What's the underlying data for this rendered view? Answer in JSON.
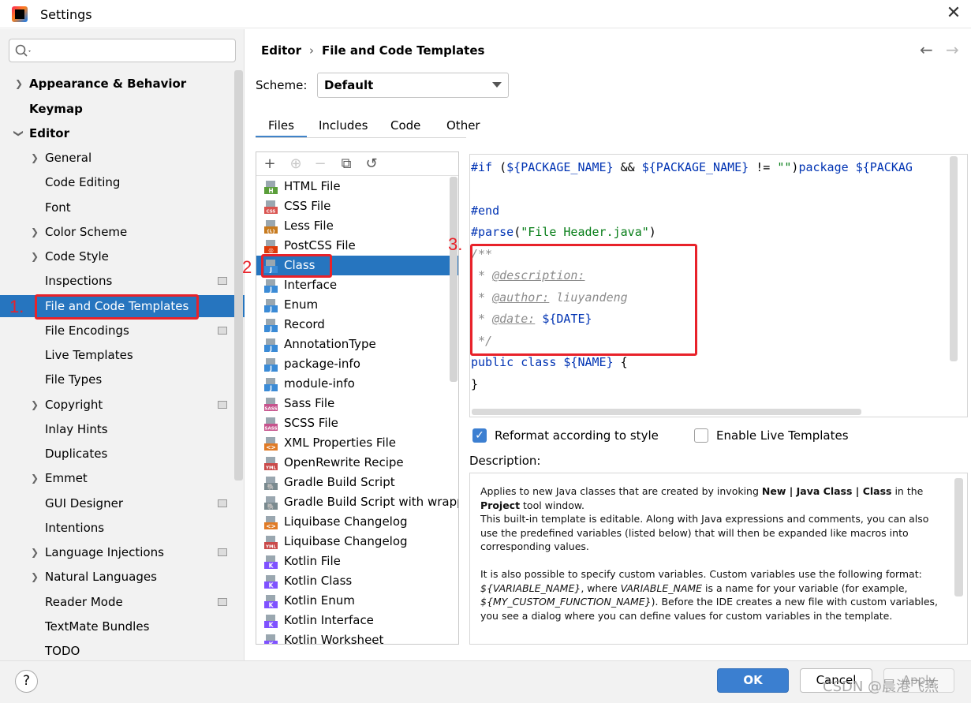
{
  "window": {
    "title": "Settings",
    "close_glyph": "✕"
  },
  "search": {
    "placeholder": ""
  },
  "sidebar": {
    "items": [
      {
        "label": "Appearance & Behavior"
      },
      {
        "label": "Keymap"
      },
      {
        "label": "Editor"
      },
      {
        "label": "General"
      },
      {
        "label": "Code Editing"
      },
      {
        "label": "Font"
      },
      {
        "label": "Color Scheme"
      },
      {
        "label": "Code Style"
      },
      {
        "label": "Inspections"
      },
      {
        "label": "File and Code Templates"
      },
      {
        "label": "File Encodings"
      },
      {
        "label": "Live Templates"
      },
      {
        "label": "File Types"
      },
      {
        "label": "Copyright"
      },
      {
        "label": "Inlay Hints"
      },
      {
        "label": "Duplicates"
      },
      {
        "label": "Emmet"
      },
      {
        "label": "GUI Designer"
      },
      {
        "label": "Intentions"
      },
      {
        "label": "Language Injections"
      },
      {
        "label": "Natural Languages"
      },
      {
        "label": "Reader Mode"
      },
      {
        "label": "TextMate Bundles"
      },
      {
        "label": "TODO"
      }
    ]
  },
  "annotations": {
    "one": "1.",
    "two": "2",
    "three": "3."
  },
  "header": {
    "crumb1": "Editor",
    "sep": "›",
    "crumb2": "File and Code Templates",
    "back": "←",
    "forward": "→"
  },
  "scheme": {
    "label": "Scheme:",
    "value": "Default"
  },
  "tabs": [
    {
      "label": "Files"
    },
    {
      "label": "Includes"
    },
    {
      "label": "Code"
    },
    {
      "label": "Other"
    }
  ],
  "toolbar": {
    "add": "+",
    "copy_child": "⊕",
    "remove": "−",
    "copy": "⧉",
    "reset": "↺"
  },
  "files": [
    {
      "label": "HTML File",
      "icon": "html-file-icon",
      "badge": "H",
      "color": "#5a9e3a"
    },
    {
      "label": "CSS File",
      "icon": "css-file-icon",
      "badge": "CSS",
      "color": "#d9534f"
    },
    {
      "label": "Less File",
      "icon": "less-file-icon",
      "badge": "{L}",
      "color": "#c77a1e"
    },
    {
      "label": "PostCSS File",
      "icon": "postcss-file-icon",
      "badge": "◎",
      "color": "#dd3a0a"
    },
    {
      "label": "Class",
      "icon": "java-class-icon",
      "badge": "J",
      "color": "#3b8bd6"
    },
    {
      "label": "Interface",
      "icon": "java-interface-icon",
      "badge": "J",
      "color": "#3b8bd6"
    },
    {
      "label": "Enum",
      "icon": "java-enum-icon",
      "badge": "J",
      "color": "#3b8bd6"
    },
    {
      "label": "Record",
      "icon": "java-record-icon",
      "badge": "J",
      "color": "#3b8bd6"
    },
    {
      "label": "AnnotationType",
      "icon": "java-annotation-icon",
      "badge": "J",
      "color": "#3b8bd6"
    },
    {
      "label": "package-info",
      "icon": "java-package-info-icon",
      "badge": "J",
      "color": "#3b8bd6"
    },
    {
      "label": "module-info",
      "icon": "java-module-info-icon",
      "badge": "J",
      "color": "#3b8bd6"
    },
    {
      "label": "Sass File",
      "icon": "sass-file-icon",
      "badge": "SASS",
      "color": "#c6538c"
    },
    {
      "label": "SCSS File",
      "icon": "scss-file-icon",
      "badge": "SASS",
      "color": "#c6538c"
    },
    {
      "label": "XML Properties File",
      "icon": "xml-file-icon",
      "badge": "<>",
      "color": "#e07b27"
    },
    {
      "label": "OpenRewrite Recipe",
      "icon": "yml-file-icon",
      "badge": "YML",
      "color": "#c94a4a"
    },
    {
      "label": "Gradle Build Script",
      "icon": "gradle-icon",
      "badge": "🐘",
      "color": "#7a8a8f"
    },
    {
      "label": "Gradle Build Script with wrapper",
      "icon": "gradle-wrapper-icon",
      "badge": "🐘",
      "color": "#7a8a8f"
    },
    {
      "label": "Liquibase Changelog",
      "icon": "liquibase-xml-icon",
      "badge": "<>",
      "color": "#e07b27"
    },
    {
      "label": "Liquibase Changelog",
      "icon": "liquibase-yml-icon",
      "badge": "YML",
      "color": "#c94a4a"
    },
    {
      "label": "Kotlin File",
      "icon": "kotlin-file-icon",
      "badge": "K",
      "color": "#7f52ff"
    },
    {
      "label": "Kotlin Class",
      "icon": "kotlin-class-icon",
      "badge": "K",
      "color": "#7f52ff"
    },
    {
      "label": "Kotlin Enum",
      "icon": "kotlin-enum-icon",
      "badge": "K",
      "color": "#7f52ff"
    },
    {
      "label": "Kotlin Interface",
      "icon": "kotlin-interface-icon",
      "badge": "K",
      "color": "#7f52ff"
    },
    {
      "label": "Kotlin Worksheet",
      "icon": "kotlin-worksheet-icon",
      "badge": "K",
      "color": "#7f52ff"
    }
  ],
  "code": {
    "l1_kw": "#if",
    "l1_a": " (",
    "l1_v1": "${PACKAGE_NAME}",
    "l1_b": " && ",
    "l1_v2": "${PACKAGE_NAME}",
    "l1_c": " != ",
    "l1_s": "\"\"",
    "l1_d": ")",
    "l1_kw2": "package",
    "l1_e": " ",
    "l1_v3": "${PACKAG",
    "l3_kw": "#end",
    "l4_kw": "#parse",
    "l4_a": "(",
    "l4_s": "\"File Header.java\"",
    "l4_b": ")",
    "l5": "/**",
    "l6_a": " * ",
    "l6_tag": "@description:",
    "l7_a": " * ",
    "l7_tag": "@author:",
    "l7_b": " liuyandeng",
    "l8_a": " * ",
    "l8_tag": "@date:",
    "l8_b": " ",
    "l8_var": "${DATE}",
    "l9": " */",
    "l10_kw": "public class",
    "l10_a": " ",
    "l10_var": "${NAME}",
    "l10_b": " {",
    "l11": "}"
  },
  "options": {
    "reformat": "Reformat according to style",
    "reformat_checked": true,
    "live": "Enable Live Templates",
    "live_checked": false
  },
  "description": {
    "label": "Description:",
    "p1_a": "Applies to new Java classes that are created by invoking ",
    "p1_b": "New | Java Class | Class",
    "p1_c": " in the ",
    "p1_d": "Project",
    "p1_e": " tool window.",
    "p1_f": "This built-in template is editable. Along with Java expressions and comments, you can also use the predefined variables (listed below) that will then be expanded like macros into corresponding values.",
    "p2_a": "It is also possible to specify custom variables. Custom variables use the following format: ",
    "p2_b": "${VARIABLE_NAME}",
    "p2_c": ", where ",
    "p2_d": "VARIABLE_NAME",
    "p2_e": " is a name for your variable (for example, ",
    "p2_f": "${MY_CUSTOM_FUNCTION_NAME}",
    "p2_g": "). Before the IDE creates a new file with custom variables, you see a dialog where you can define values for custom variables in the template."
  },
  "buttons": {
    "help": "?",
    "ok": "OK",
    "cancel": "Cancel",
    "apply": "Apply"
  },
  "watermark": "CSDN @晨港飞燕",
  "colors": {
    "selection": "#2675bf",
    "annotation": "#e8222a",
    "ok": "#3b7fd0"
  }
}
